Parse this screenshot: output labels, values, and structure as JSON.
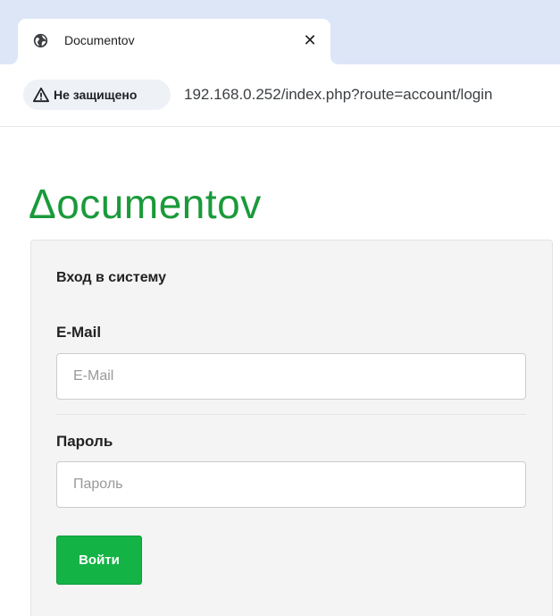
{
  "browser": {
    "tab": {
      "title": "Documentov",
      "close_glyph": "✕",
      "favicon": "globe-icon"
    },
    "address_bar": {
      "security_icon": "warning-triangle-icon",
      "security_label": "Не защищено",
      "url": "192.168.0.252/index.php?route=account/login"
    }
  },
  "page": {
    "logo": "Δocumentov",
    "login_panel": {
      "title": "Вход в систему",
      "email_label": "E-Mail",
      "email_placeholder": "E-Mail",
      "email_value": "",
      "password_label": "Пароль",
      "password_placeholder": "Пароль",
      "password_value": "",
      "submit_label": "Войти"
    }
  },
  "colors": {
    "brand_green": "#1a9a3a",
    "button_green": "#14b345",
    "tabstrip_bg": "#dce6f7"
  }
}
